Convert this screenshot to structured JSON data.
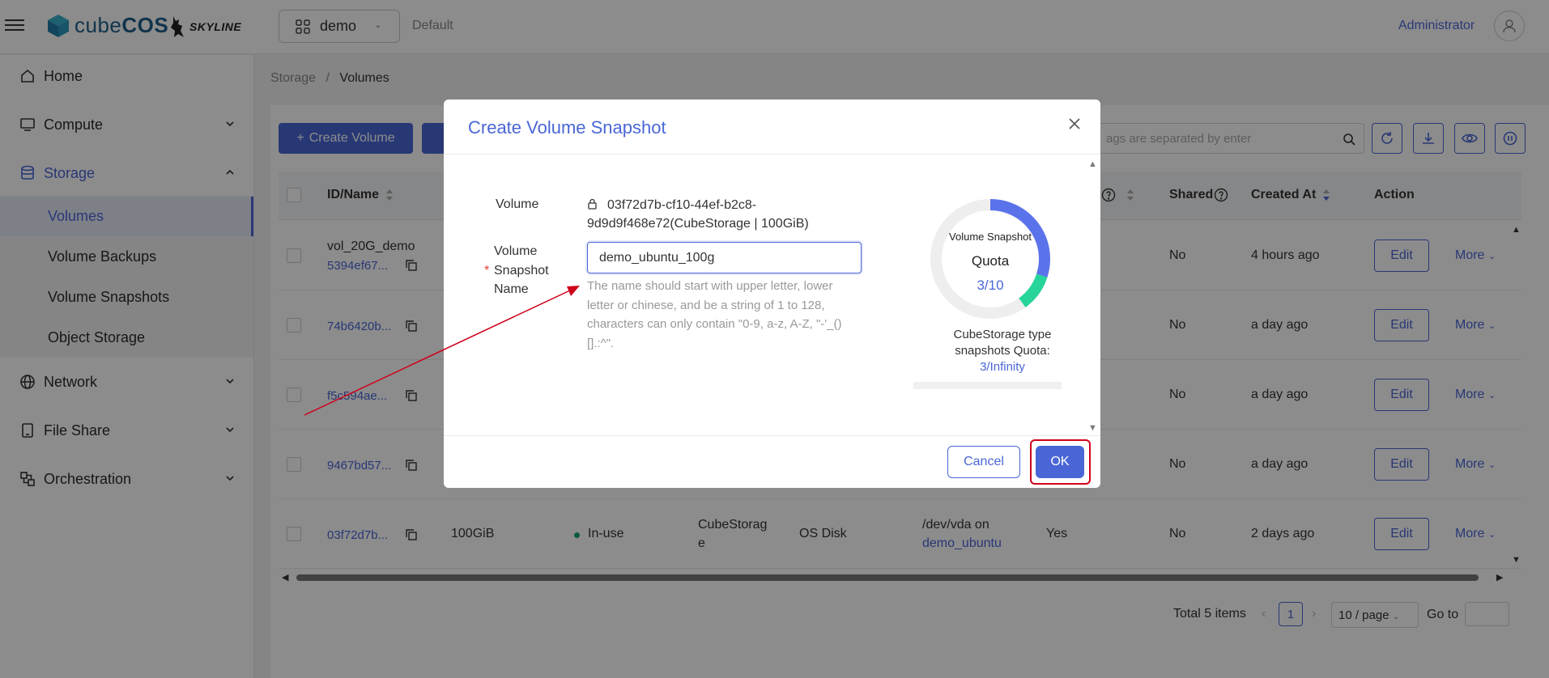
{
  "header": {
    "logo_text_a": "cube",
    "logo_text_b": "COS",
    "partner": "SKYLINE",
    "project": "demo",
    "domain": "Default",
    "user": "Administrator"
  },
  "sidebar": {
    "items": [
      {
        "label": "Home"
      },
      {
        "label": "Compute"
      },
      {
        "label": "Storage"
      },
      {
        "label": "Network"
      },
      {
        "label": "File Share"
      },
      {
        "label": "Orchestration"
      }
    ],
    "storage_sub": [
      {
        "label": "Volumes"
      },
      {
        "label": "Volume Backups"
      },
      {
        "label": "Volume Snapshots"
      },
      {
        "label": "Object Storage"
      }
    ]
  },
  "breadcrumb": {
    "parent": "Storage",
    "sep": "/",
    "current": "Volumes"
  },
  "toolbar": {
    "create_label": "Create Volume",
    "plus": "+",
    "search_placeholder": "ags are separated by enter"
  },
  "table": {
    "headers": {
      "id_name": "ID/Name",
      "shared": "Shared",
      "created": "Created At",
      "action": "Action"
    },
    "rows": [
      {
        "name": "vol_20G_demo",
        "id": "5394ef67...",
        "shared": "No",
        "created": "4 hours ago"
      },
      {
        "name": "",
        "id": "74b6420b...",
        "shared": "No",
        "created": "a day ago"
      },
      {
        "name": "",
        "id": "f5c594ae...",
        "shared": "No",
        "created": "a day ago"
      },
      {
        "name": "",
        "id": "9467bd57...",
        "shared": "No",
        "created": "a day ago"
      },
      {
        "name": "",
        "id": "03f72d7b...",
        "size": "100GiB",
        "status": "In-use",
        "type_a": "CubeStorag",
        "type_b": "e",
        "disk": "OS Disk",
        "attach_a": "/dev/vda on",
        "attach_b": "demo_ubuntu",
        "bootable": "Yes",
        "shared": "No",
        "created": "2 days ago"
      }
    ],
    "edit_label": "Edit",
    "more_label": "More"
  },
  "pagination": {
    "total": "Total 5 items",
    "page": "1",
    "per_page": "10 / page",
    "goto": "Go to"
  },
  "modal": {
    "title": "Create Volume Snapshot",
    "volume_label": "Volume",
    "volume_value_1": "03f72d7b-cf10-44ef-b2c8-",
    "volume_value_2": "9d9d9f468e72(CubeStorage | 100GiB)",
    "name_label_1": "Volume",
    "name_label_2": "Snapshot",
    "name_label_3": "Name",
    "required_mark": "*",
    "name_value": "demo_ubuntu_100g",
    "hint": "The name should start with upper letter, lower letter or chinese, and be a string of 1 to 128, characters can only contain \"0-9, a-z, A-Z, \"-'_()[].:^\".",
    "quota": {
      "title": "Volume Snapshot",
      "label": "Quota",
      "value": "3/10",
      "used": 3,
      "total": 10,
      "adding": 1,
      "type_caption": "CubeStorage type snapshots Quota:",
      "type_value": "3/Infinity"
    },
    "cancel": "Cancel",
    "ok": "OK"
  },
  "colors": {
    "primary": "#4a66d6",
    "quota_used": "#5b73ea",
    "quota_add": "#27d49a",
    "annotation": "#d0021b"
  }
}
